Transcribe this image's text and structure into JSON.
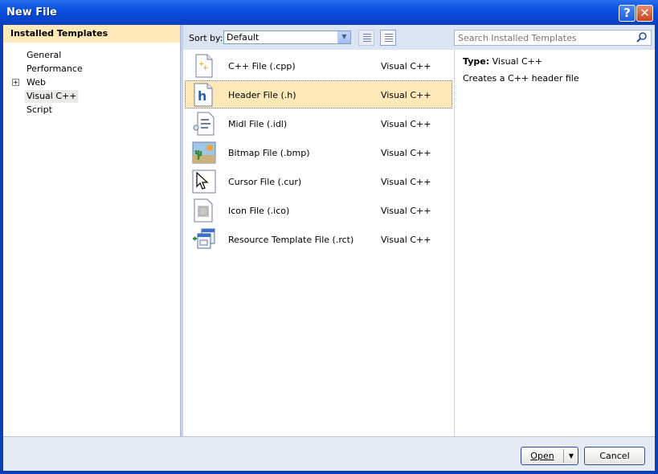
{
  "window": {
    "title": "New File",
    "help_glyph": "?",
    "close_glyph": "✕"
  },
  "left": {
    "header": "Installed Templates",
    "items": [
      {
        "label": "General",
        "expander": ""
      },
      {
        "label": "Performance",
        "expander": ""
      },
      {
        "label": "Web",
        "expander": "+"
      },
      {
        "label": "Visual C++",
        "expander": "",
        "selected": true
      },
      {
        "label": "Script",
        "expander": ""
      }
    ]
  },
  "toolbar": {
    "sort_label": "Sort by:",
    "sort_value": "Default",
    "search_placeholder": "Search Installed Templates"
  },
  "templates": [
    {
      "name": "C++ File (.cpp)",
      "language": "Visual C++",
      "icon": "cpp-file-icon"
    },
    {
      "name": "Header File (.h)",
      "language": "Visual C++",
      "icon": "header-file-icon",
      "selected": true
    },
    {
      "name": "Midl File (.idl)",
      "language": "Visual C++",
      "icon": "midl-file-icon"
    },
    {
      "name": "Bitmap File (.bmp)",
      "language": "Visual C++",
      "icon": "bitmap-file-icon"
    },
    {
      "name": "Cursor File (.cur)",
      "language": "Visual C++",
      "icon": "cursor-file-icon"
    },
    {
      "name": "Icon File (.ico)",
      "language": "Visual C++",
      "icon": "icon-file-icon"
    },
    {
      "name": "Resource Template File (.rct)",
      "language": "Visual C++",
      "icon": "resource-template-icon"
    }
  ],
  "details": {
    "type_label": "Type:",
    "type_value": "Visual C++",
    "description": "Creates a C++ header file"
  },
  "buttons": {
    "open": "Open",
    "cancel": "Cancel"
  },
  "colors": {
    "title_bar": "#0a53e0",
    "selection": "#fde8b8"
  }
}
